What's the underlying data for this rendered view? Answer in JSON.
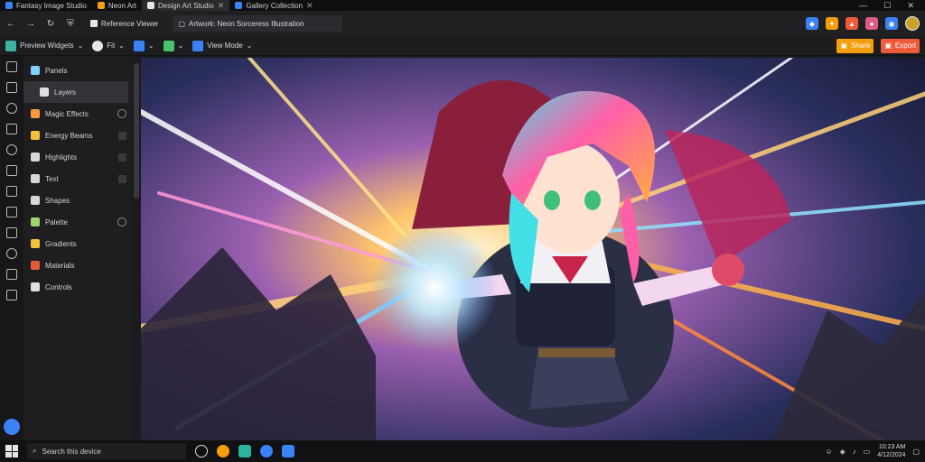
{
  "tabs": [
    {
      "label": "Fantasy Image Studio",
      "active": false
    },
    {
      "label": "Neon Art",
      "active": false
    },
    {
      "label": "Design Art Studio",
      "active": true
    },
    {
      "label": "Gallery Collection",
      "active": false
    }
  ],
  "window_controls": [
    "minimize",
    "maximize",
    "close"
  ],
  "address": {
    "page_label": "Reference Viewer",
    "url": "Artwork: Neon Sorceress Illustration"
  },
  "toolbar": {
    "workspace_label": "Preview Widgets",
    "zoom_label": "Fit",
    "mode_label": "View Mode",
    "share_label": "Share",
    "export_label": "Export"
  },
  "sidebar": {
    "items": [
      {
        "label": "Panels",
        "icon": "layers-icon",
        "color": "#7fd1ff"
      },
      {
        "label": "Layers",
        "icon": "square-icon",
        "color": "#e0e0e0",
        "selected": true
      },
      {
        "label": "Magic Effects",
        "icon": "brush-icon",
        "color": "#ff9a3c"
      },
      {
        "label": "Energy Beams",
        "icon": "bolt-icon",
        "color": "#f3c23a"
      },
      {
        "label": "Highlights",
        "icon": "star-icon",
        "color": "#d7d7d7"
      },
      {
        "label": "Text",
        "icon": "text-icon",
        "color": "#d7d7d7"
      },
      {
        "label": "Shapes",
        "icon": "shape-icon",
        "color": "#d7d7d7"
      },
      {
        "label": "Palette",
        "icon": "palette-icon",
        "color": "#9ad66b"
      },
      {
        "label": "Gradients",
        "icon": "gradient-icon",
        "color": "#f3c23a"
      },
      {
        "label": "Materials",
        "icon": "material-icon",
        "color": "#e05a3a"
      },
      {
        "label": "Controls",
        "icon": "wand-icon",
        "color": "#e0e0e0"
      }
    ]
  },
  "taskbar": {
    "search_placeholder": "Search this device",
    "clock_time": "10:23 AM",
    "clock_date": "4/12/2024"
  },
  "colors": {
    "accent": "#3b82f6",
    "share": "#f59e0b",
    "export": "#ef5a3a"
  }
}
